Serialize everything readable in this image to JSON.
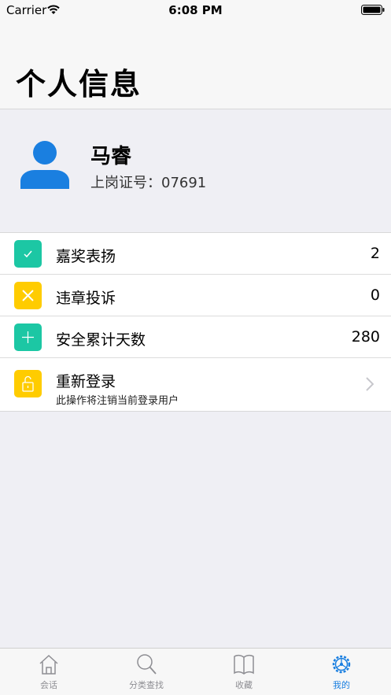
{
  "status_bar": {
    "carrier": "Carrier",
    "time": "6:08 PM"
  },
  "header": {
    "title": "个人信息"
  },
  "profile": {
    "name": "马睿",
    "id_label": "上岗证号：07691"
  },
  "list": [
    {
      "icon": "checkmark-icon",
      "color": "#1cc7a4",
      "label": "嘉奖表扬",
      "value": "2"
    },
    {
      "icon": "cross-icon",
      "color": "#ffcc00",
      "label": "违章投诉",
      "value": "0"
    },
    {
      "icon": "plus-icon",
      "color": "#1cc7a4",
      "label": "安全累计天数",
      "value": "280"
    },
    {
      "icon": "unlock-icon",
      "color": "#ffcc00",
      "label": "重新登录",
      "sub": "此操作将注销当前登录用户"
    }
  ],
  "tabs": [
    {
      "icon": "house-icon",
      "label": "会话"
    },
    {
      "icon": "magnifier-icon",
      "label": "分类查找"
    },
    {
      "icon": "book-icon",
      "label": "收藏"
    },
    {
      "icon": "gear-icon",
      "label": "我的",
      "active": true
    }
  ],
  "colors": {
    "accent": "#1a7fe0",
    "avatar": "#1a7fe0",
    "teal": "#1cc7a4",
    "yellow": "#ffcc00"
  }
}
